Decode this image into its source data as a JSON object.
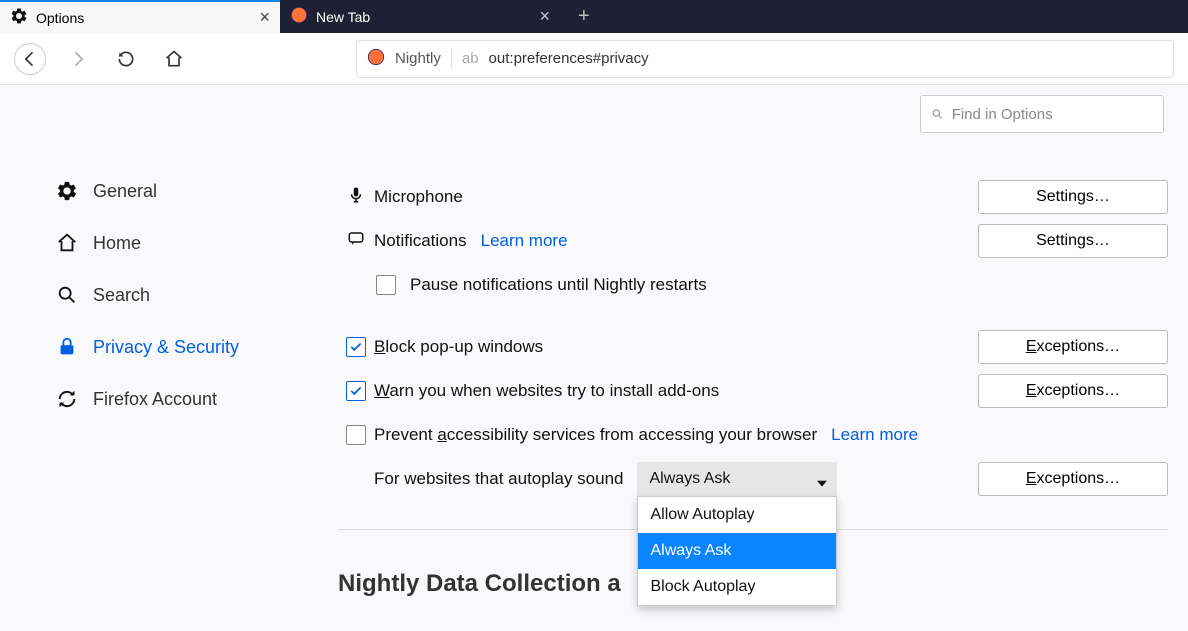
{
  "tabs": {
    "options": {
      "label": "Options"
    },
    "newtab": {
      "label": "New Tab"
    }
  },
  "urlbar": {
    "identity_label": "Nightly",
    "url_dim": "ab",
    "url_rest": "out:preferences#privacy"
  },
  "search": {
    "placeholder": "Find in Options"
  },
  "sidebar": {
    "general": "General",
    "home": "Home",
    "search": "Search",
    "privacy": "Privacy & Security",
    "account": "Firefox Account"
  },
  "settings": {
    "microphone_label": "Microphone",
    "notifications_label": "Notifications",
    "learn_more": "Learn more",
    "pause_notifications": "Pause notifications until Nightly restarts",
    "block_popups_prefix": "B",
    "block_popups_rest": "lock pop-up windows",
    "warn_addons_prefix": "W",
    "warn_addons_rest": "arn you when websites try to install add-ons",
    "prevent_a11y_pre": "Prevent ",
    "prevent_a11y_key": "a",
    "prevent_a11y_post": "ccessibility services from accessing your browser",
    "autoplay_label": "For websites that autoplay sound",
    "buttons": {
      "settings_key": "S",
      "settings_pre": "Settin",
      "settings_key2": "g",
      "settings_post": "s…",
      "exceptions_pre": "E",
      "exceptions_post": "xceptions…"
    },
    "autoplay_select": {
      "value": "Always Ask",
      "options": [
        "Allow Autoplay",
        "Always Ask",
        "Block Autoplay"
      ],
      "selected_index": 1
    },
    "section_title_partial": "Nightly Data Collection a"
  }
}
